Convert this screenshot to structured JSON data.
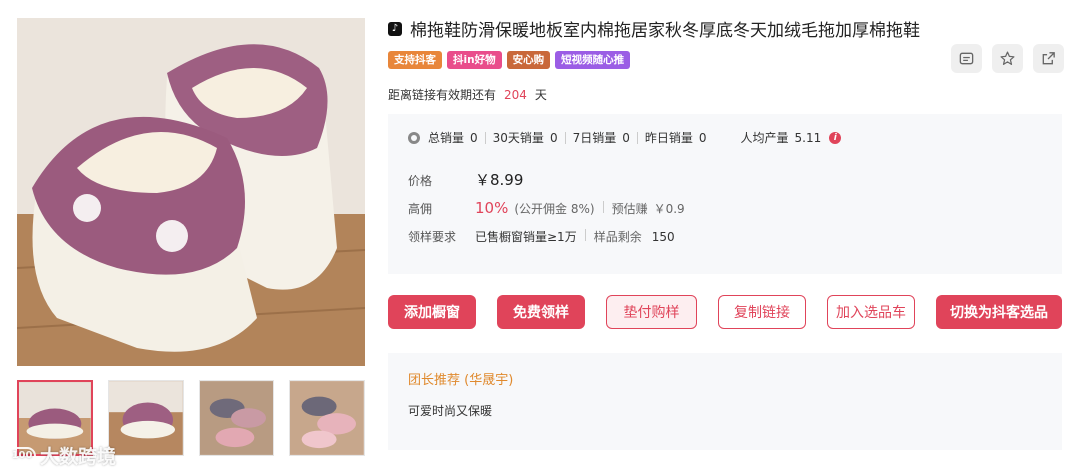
{
  "product": {
    "title": "棉拖鞋防滑保暖地板室内棉拖居家秋冬厚底冬天加绒毛拖加厚棉拖鞋",
    "platform_icon": "douyin-icon",
    "tags": [
      {
        "label": "支持抖客",
        "color": "#e8863a"
      },
      {
        "label": "抖in好物",
        "color": "#e94d8b"
      },
      {
        "label": "安心购",
        "color": "#c9683a"
      },
      {
        "label": "短视频随心推",
        "color": "#9b5de5"
      }
    ]
  },
  "expiry": {
    "prefix": "距离链接有效期还有",
    "days": "204",
    "suffix": "天"
  },
  "stats": {
    "items": [
      {
        "label": "总销量",
        "value": "0"
      },
      {
        "label": "30天销量",
        "value": "0"
      },
      {
        "label": "7日销量",
        "value": "0"
      },
      {
        "label": "昨日销量",
        "value": "0"
      }
    ],
    "per_capita_label": "人均产量",
    "per_capita_value": "5.11",
    "info_glyph": "i"
  },
  "pricing": {
    "price_label": "价格",
    "price": "￥8.99",
    "commission_label": "高佣",
    "commission": "10%",
    "public_commission": "(公开佣金 8%)",
    "est_label": "预估赚",
    "est_value": "￥0.9",
    "sample_label": "领样要求",
    "sample_req": "已售橱窗销量≥1万",
    "remain_label": "样品剩余",
    "remain_value": "150"
  },
  "buttons": {
    "add_window": "添加橱窗",
    "free_sample": "免费领样",
    "paid_sample": "垫付购样",
    "copy_link": "复制链接",
    "add_cart": "加入选品车",
    "switch": "切换为抖客选品"
  },
  "recommendation": {
    "title": "团长推荐 (华晟宇)",
    "text": "可爱时尚又保暖"
  },
  "watermark": {
    "logo": "100",
    "text": "大数跨境"
  },
  "colors": {
    "accent": "#e0445a",
    "orange": "#e08a2e"
  },
  "action_icons": [
    "message-icon",
    "star-icon",
    "share-icon"
  ]
}
